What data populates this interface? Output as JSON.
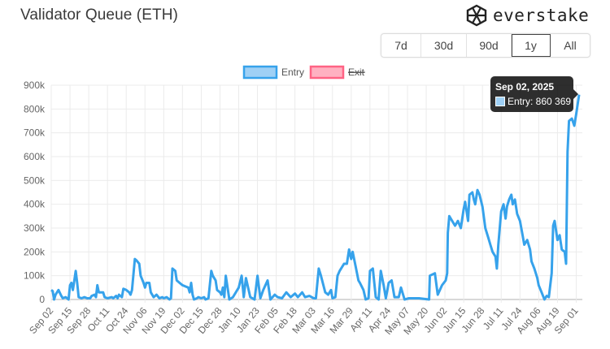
{
  "header": {
    "title": "Validator Queue (ETH)",
    "logo_text": "everstake"
  },
  "ranges": [
    {
      "label": "7d",
      "active": false
    },
    {
      "label": "30d",
      "active": false
    },
    {
      "label": "90d",
      "active": false
    },
    {
      "label": "1y",
      "active": true
    },
    {
      "label": "All",
      "active": false
    }
  ],
  "tooltip": {
    "date": "Sep 02, 2025",
    "text": "Entry: 860 369"
  },
  "chart_data": {
    "type": "line",
    "title": "Validator Queue (ETH)",
    "legend": [
      {
        "name": "Entry",
        "color": "#36a2eb",
        "fill": "#9fd0f5",
        "hidden": false
      },
      {
        "name": "Exit",
        "color": "#ff6384",
        "fill": "#ffb1c1",
        "hidden": true
      }
    ],
    "legend_position": "top",
    "x_unit": "days since Sep 02, 2024",
    "xlim": [
      0,
      366
    ],
    "x_ticks": [
      "Sep 02",
      "Sep 15",
      "Sep 28",
      "Oct 11",
      "Oct 24",
      "Nov 06",
      "Nov 19",
      "Dec 02",
      "Dec 15",
      "Dec 28",
      "Jan 10",
      "Jan 23",
      "Feb 05",
      "Feb 18",
      "Mar 03",
      "Mar 16",
      "Mar 29",
      "Apr 11",
      "Apr 24",
      "May 07",
      "May 20",
      "Jun 02",
      "Jun 15",
      "Jun 28",
      "Jul 11",
      "Jul 24",
      "Aug 06",
      "Aug 19",
      "Sep 01"
    ],
    "x_tick_step_days": 13,
    "y_ticks": [
      "0",
      "100k",
      "200k",
      "300k",
      "400k",
      "500k",
      "600k",
      "700k",
      "800k",
      "900k"
    ],
    "ylim": [
      0,
      900000
    ],
    "grid": true,
    "series": [
      {
        "name": "Entry",
        "unit": "thousand ETH",
        "points": [
          [
            0,
            40
          ],
          [
            1,
            35
          ],
          [
            2,
            0
          ],
          [
            3,
            20
          ],
          [
            5,
            40
          ],
          [
            7,
            15
          ],
          [
            8,
            5
          ],
          [
            10,
            10
          ],
          [
            12,
            0
          ],
          [
            13,
            60
          ],
          [
            14,
            70
          ],
          [
            15,
            40
          ],
          [
            16,
            80
          ],
          [
            17,
            120
          ],
          [
            18,
            70
          ],
          [
            19,
            10
          ],
          [
            21,
            5
          ],
          [
            23,
            10
          ],
          [
            25,
            5
          ],
          [
            27,
            5
          ],
          [
            28,
            15
          ],
          [
            30,
            20
          ],
          [
            31,
            10
          ],
          [
            32,
            60
          ],
          [
            33,
            30
          ],
          [
            36,
            30
          ],
          [
            37,
            10
          ],
          [
            39,
            5
          ],
          [
            42,
            10
          ],
          [
            43,
            5
          ],
          [
            45,
            15
          ],
          [
            46,
            5
          ],
          [
            47,
            20
          ],
          [
            49,
            10
          ],
          [
            50,
            45
          ],
          [
            52,
            40
          ],
          [
            54,
            30
          ],
          [
            55,
            20
          ],
          [
            56,
            40
          ],
          [
            58,
            170
          ],
          [
            59,
            165
          ],
          [
            61,
            150
          ],
          [
            62,
            100
          ],
          [
            64,
            70
          ],
          [
            65,
            50
          ],
          [
            66,
            70
          ],
          [
            68,
            70
          ],
          [
            69,
            30
          ],
          [
            71,
            10
          ],
          [
            73,
            20
          ],
          [
            75,
            5
          ],
          [
            77,
            10
          ],
          [
            78,
            5
          ],
          [
            80,
            10
          ],
          [
            82,
            0
          ],
          [
            83,
            5
          ],
          [
            84,
            130
          ],
          [
            86,
            120
          ],
          [
            87,
            80
          ],
          [
            89,
            70
          ],
          [
            91,
            60
          ],
          [
            93,
            55
          ],
          [
            95,
            50
          ],
          [
            96,
            30
          ],
          [
            97,
            70
          ],
          [
            98,
            20
          ],
          [
            99,
            0
          ],
          [
            101,
            5
          ],
          [
            102,
            10
          ],
          [
            104,
            5
          ],
          [
            106,
            10
          ],
          [
            107,
            0
          ],
          [
            109,
            5
          ],
          [
            111,
            120
          ],
          [
            112,
            100
          ],
          [
            114,
            80
          ],
          [
            115,
            40
          ],
          [
            117,
            30
          ],
          [
            118,
            20
          ],
          [
            119,
            50
          ],
          [
            120,
            10
          ],
          [
            121,
            100
          ],
          [
            123.5,
            0
          ],
          [
            126,
            10
          ],
          [
            130,
            50
          ],
          [
            132,
            100
          ],
          [
            133.5,
            10
          ],
          [
            135,
            90
          ],
          [
            138,
            10
          ],
          [
            141,
            0
          ],
          [
            143,
            100
          ],
          [
            145,
            5
          ],
          [
            147,
            40
          ],
          [
            150,
            80
          ],
          [
            152,
            0
          ],
          [
            155,
            20
          ],
          [
            157,
            10
          ],
          [
            160,
            5
          ],
          [
            163,
            30
          ],
          [
            166,
            10
          ],
          [
            169,
            25
          ],
          [
            171,
            10
          ],
          [
            174,
            30
          ],
          [
            176,
            10
          ],
          [
            179,
            15
          ],
          [
            182,
            5
          ],
          [
            183.5,
            5
          ],
          [
            185.5,
            130
          ],
          [
            187,
            100
          ],
          [
            190,
            30
          ],
          [
            192,
            20
          ],
          [
            194,
            40
          ],
          [
            195,
            5
          ],
          [
            197,
            10
          ],
          [
            198.5,
            100
          ],
          [
            200,
            120
          ],
          [
            203,
            150
          ],
          [
            205,
            150
          ],
          [
            206.5,
            210
          ],
          [
            208,
            170
          ],
          [
            209,
            200
          ],
          [
            211,
            140
          ],
          [
            213,
            80
          ],
          [
            214,
            70
          ],
          [
            216.5,
            40
          ],
          [
            218,
            0
          ],
          [
            220,
            5
          ],
          [
            221,
            120
          ],
          [
            223,
            130
          ],
          [
            225,
            10
          ],
          [
            227,
            0
          ],
          [
            228.5,
            120
          ],
          [
            230.5,
            60
          ],
          [
            232,
            5
          ],
          [
            234,
            70
          ],
          [
            236,
            80
          ],
          [
            238,
            10
          ],
          [
            241,
            10
          ],
          [
            242.5,
            50
          ],
          [
            245,
            0
          ],
          [
            248,
            5
          ],
          [
            255,
            5
          ],
          [
            262,
            0
          ],
          [
            262.5,
            100
          ],
          [
            266,
            110
          ],
          [
            268,
            20
          ],
          [
            271,
            60
          ],
          [
            273.5,
            80
          ],
          [
            274.5,
            110
          ],
          [
            275,
            280
          ],
          [
            276,
            350
          ],
          [
            279,
            320
          ],
          [
            280,
            310
          ],
          [
            282,
            330
          ],
          [
            284,
            300
          ],
          [
            286,
            380
          ],
          [
            287,
            410
          ],
          [
            289,
            330
          ],
          [
            290,
            440
          ],
          [
            292,
            450
          ],
          [
            293,
            420
          ],
          [
            294,
            400
          ],
          [
            295.5,
            460
          ],
          [
            297,
            440
          ],
          [
            299,
            390
          ],
          [
            301,
            300
          ],
          [
            303,
            260
          ],
          [
            304.5,
            230
          ],
          [
            306,
            200
          ],
          [
            308,
            180
          ],
          [
            309,
            130
          ],
          [
            310,
            230
          ],
          [
            312,
            370
          ],
          [
            313.6,
            400
          ],
          [
            315,
            340
          ],
          [
            316,
            390
          ],
          [
            317.5,
            420
          ],
          [
            319,
            440
          ],
          [
            320,
            400
          ],
          [
            321.5,
            420
          ],
          [
            323,
            360
          ],
          [
            325,
            330
          ],
          [
            326.5,
            280
          ],
          [
            328,
            230
          ],
          [
            330,
            250
          ],
          [
            332,
            210
          ],
          [
            333,
            160
          ],
          [
            335,
            130
          ],
          [
            337,
            90
          ],
          [
            338,
            60
          ],
          [
            340,
            30
          ],
          [
            342,
            0
          ],
          [
            343.5,
            15
          ],
          [
            345,
            10
          ],
          [
            347,
            110
          ],
          [
            348,
            310
          ],
          [
            349,
            330
          ],
          [
            351,
            250
          ],
          [
            352.5,
            270
          ],
          [
            354,
            210
          ],
          [
            356,
            200
          ],
          [
            357,
            150
          ],
          [
            358,
            620
          ],
          [
            359,
            750
          ],
          [
            361,
            760
          ],
          [
            362.7,
            730
          ],
          [
            364,
            780
          ],
          [
            366,
            860.369
          ]
        ]
      }
    ],
    "highlight": {
      "date": "Sep 02, 2025",
      "series": "Entry",
      "value": 860369
    }
  }
}
